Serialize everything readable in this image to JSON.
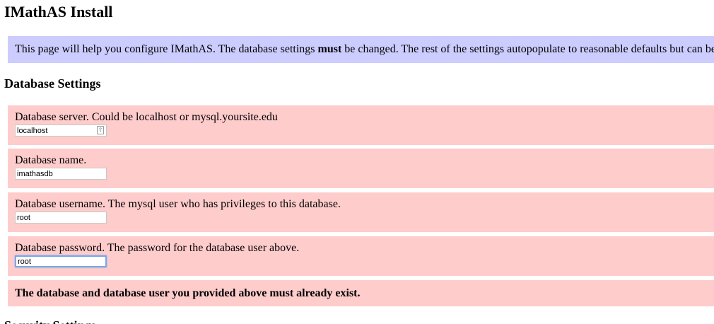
{
  "title": "IMathAS Install",
  "intro": {
    "before": "This page will help you configure IMathAS. The database settings ",
    "bold": "must",
    "after": " be changed. The rest of the settings autopopulate to reasonable defaults but can be"
  },
  "section_heading": "Database Settings",
  "settings": [
    {
      "label": "Database server. Could be localhost or mysql.yoursite.edu",
      "value": "localhost"
    },
    {
      "label": "Database name.",
      "value": "imathasdb"
    },
    {
      "label": "Database username. The mysql user who has privileges to this database.",
      "value": "root"
    },
    {
      "label": "Database password. The password for the database user above.",
      "value": "root"
    }
  ],
  "note": "The database and database user you provided above must already exist.",
  "next_heading": "Security Settings",
  "keychain_icon": "key-icon"
}
